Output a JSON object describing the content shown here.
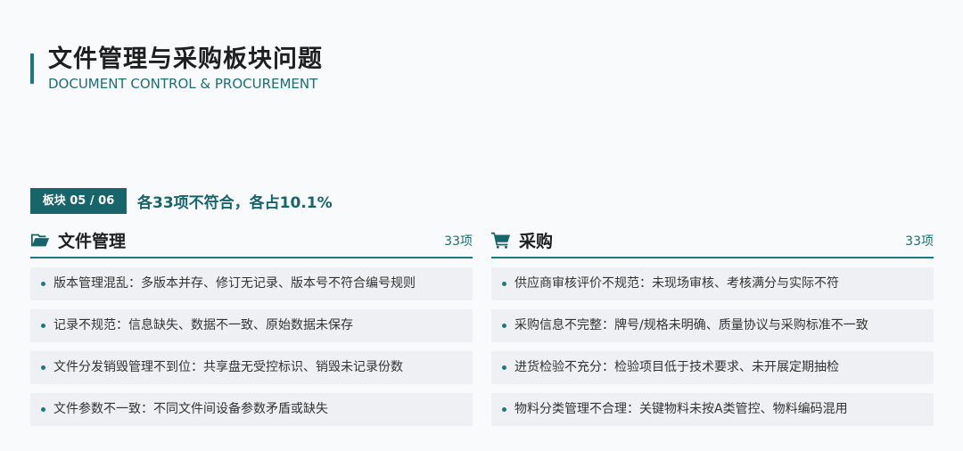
{
  "header": {
    "title": "文件管理与采购板块问题",
    "subtitle": "DOCUMENT CONTROL & PROCUREMENT"
  },
  "summary": {
    "badge": "板块 05 / 06",
    "text": "各33项不符合，各占10.1%"
  },
  "panels": [
    {
      "icon": "folder-open-icon",
      "title": "文件管理",
      "count": "33项",
      "items": [
        "版本管理混乱：多版本并存、修订无记录、版本号不符合编号规则",
        "记录不规范：信息缺失、数据不一致、原始数据未保存",
        "文件分发销毁管理不到位：共享盘无受控标识、销毁未记录份数",
        "文件参数不一致：不同文件间设备参数矛盾或缺失"
      ]
    },
    {
      "icon": "shopping-cart-icon",
      "title": "采购",
      "count": "33项",
      "items": [
        "供应商审核评价不规范：未现场审核、考核满分与实际不符",
        "采购信息不完整：牌号/规格未明确、质量协议与采购标准不一致",
        "进货检验不充分：检验项目低于技术要求、未开展定期抽检",
        "物料分类管理不合理：关键物料未按A类管控、物料编码混用"
      ]
    }
  ],
  "colors": {
    "accent": "#1a7a80",
    "badge_bg": "#17646b",
    "item_bg": "#eef0f3",
    "background": "#f9fafc"
  }
}
